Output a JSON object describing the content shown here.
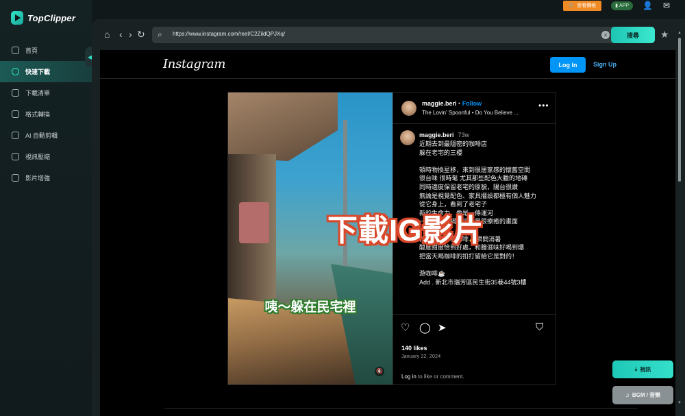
{
  "app": {
    "name": "TopClipper",
    "price_label": "查看價格",
    "app_label": "APP"
  },
  "sidebar": {
    "items": [
      {
        "label": "首頁",
        "icon": "home-icon"
      },
      {
        "label": "快速下載",
        "icon": "search-icon",
        "active": true
      },
      {
        "label": "下載清單",
        "icon": "download-list-icon"
      },
      {
        "label": "格式轉換",
        "icon": "convert-icon"
      },
      {
        "label": "AI 自動剪輯",
        "icon": "ai-edit-icon"
      },
      {
        "label": "視訊壓縮",
        "icon": "compress-icon"
      },
      {
        "label": "影片增強",
        "icon": "enhance-icon"
      }
    ]
  },
  "browser": {
    "url": "https://www.instagram.com/reel/C2ZildQPJXq/",
    "search_label": "搜尋"
  },
  "instagram": {
    "logo": "Instagram",
    "login_label": "Log In",
    "signup_label": "Sign Up",
    "post": {
      "username": "maggie.beri",
      "follow_label": "Follow",
      "music": "The Lovin' Spoonful • Do You Believe ...",
      "caption_user": "maggie.beri",
      "caption_time": "73w",
      "caption": "近期去到最隱密的咖啡店\n躲在老宅的三樓\n\n頓時物換星移，來到很居家感的懷舊空間\n很台味 很時髦 尤其那些配色大膽的地磚\n同時適度保留老宅的原貌，陽台很讚\n無論是視覺配色、家具擺設都極有個人魅力\n從它身上，看到了老宅子\n新的生命力，像是一條運河\n一起在這裡喝咖啡，是很療癒的畫面\n\n西西里冰檸檬咖啡✨瞬間消暑\n酸度甜度恰到好處，和膾滋味好喝到爆\n把當天喝咖啡的扣打留給它是對的！\n\n游咖啡☕\nAdd . 新北市瑞芳區民生街35巷44號3樓",
      "video_caption": "咦～躲在民宅裡",
      "likes": "140 likes",
      "date": "January 22, 2024",
      "login_prompt_link": "Log in",
      "login_prompt_rest": " to like or comment."
    }
  },
  "overlay": {
    "title": "下載IG影片"
  },
  "floating": {
    "video_label": "視訊",
    "bgm_label": "BGM / 音樂"
  },
  "colors": {
    "accent": "#32e2c7",
    "ig_blue": "#0095f6",
    "price_orange": "#f08a24",
    "overlay_red": "#d9482b"
  }
}
